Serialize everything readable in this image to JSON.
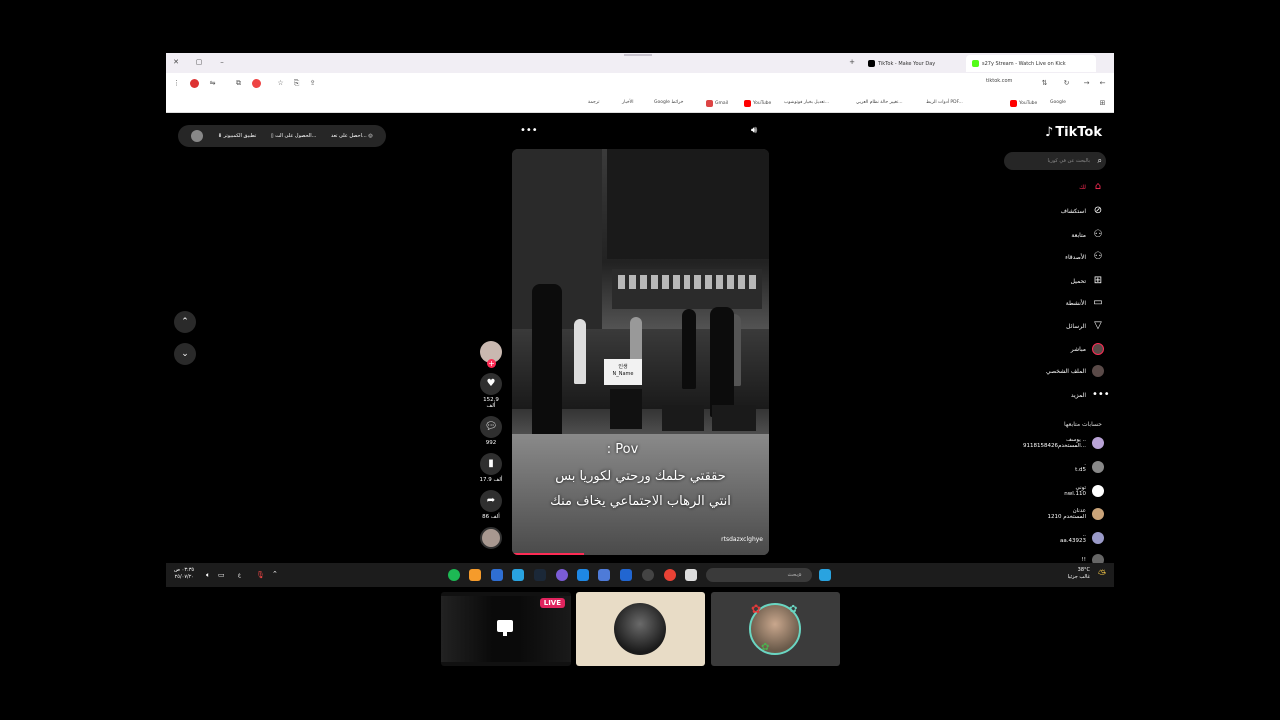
{
  "browser": {
    "tabs": [
      {
        "label": "TikTok - Make Your Day",
        "icon": "tiktok-favicon"
      },
      {
        "label": "s27y Stream - Watch Live on Kick",
        "icon": "kick-favicon"
      }
    ],
    "url": "tiktok.com",
    "bookmarks": [
      "Google",
      "YouTube",
      "أدوات الربط PDF...",
      "تغيير حالة نظام العربي...",
      "تعديل بخيار فوتوشوب...",
      "YouTube",
      "Gmail",
      "Google خرائط",
      "الأخبار",
      "ترجمة"
    ]
  },
  "getbar": {
    "item1": "احصل على تعد...",
    "item2": "الحصول على الت...",
    "item3": "تطبيق الكمبيوتر"
  },
  "video": {
    "sign_line1": "인생",
    "sign_line2": "N_Name",
    "caption1": "Pov :",
    "caption2": "حققتي حلمك ورحتي لكوريا بس",
    "caption3": "انتي الرهاب الاجتماعي يخاف منك",
    "watermark": "rtsdazxclghye",
    "progress_percent": 28
  },
  "actions": {
    "likes": "152.9 ألف",
    "comments": "992",
    "saves": "17.9 ألف",
    "shares": "86 ألف"
  },
  "sidebar": {
    "logo": "TikTok",
    "search_placeholder": "بالبحث عن في كوريا",
    "nav": [
      {
        "label": "لك",
        "icon": "home-icon",
        "active": true
      },
      {
        "label": "استكشاف",
        "icon": "compass-icon",
        "active": false
      },
      {
        "label": "متابعة",
        "icon": "following-icon",
        "active": false
      },
      {
        "label": "الأصدقاء",
        "icon": "friends-icon",
        "active": false
      },
      {
        "label": "تحميل",
        "icon": "upload-icon",
        "active": false
      },
      {
        "label": "الأنشطة",
        "icon": "activity-icon",
        "active": false
      },
      {
        "label": "الرسائل",
        "icon": "messages-icon",
        "active": false
      },
      {
        "label": "مباشر",
        "icon": "live-icon",
        "active": false
      },
      {
        "label": "الملف الشخصي",
        "icon": "profile-icon",
        "active": false
      },
      {
        "label": "المزيد",
        "icon": "more-icon",
        "active": false
      }
    ],
    "following_title": "حسابات متابعها",
    "accounts": [
      {
        "name": "يوسف ..",
        "handle": "المستخدم9118158426...",
        "color": "#b9a3d6"
      },
      {
        "name": ".",
        "handle": "t.d5",
        "color": "#888888"
      },
      {
        "name": "توني",
        "handle": "nwl.110",
        "color": "#ffffff"
      },
      {
        "name": "عدنان",
        "handle": "المستخدم 1210",
        "color": "#caa47a"
      },
      {
        "name": "..",
        "handle": "aa.43923",
        "color": "#9a9ac8"
      },
      {
        "name": "!!",
        "handle": "",
        "color": "#666666"
      }
    ]
  },
  "taskbar": {
    "weather_temp": "38°C",
    "weather_desc": "غالب جزئيا",
    "search_placeholder": "بحث",
    "time": "٠٣:٣٥ ص",
    "date": "٢٥/٠٧/٢٠",
    "lang": "ع"
  },
  "tiles": {
    "live_badge": "LIVE"
  }
}
